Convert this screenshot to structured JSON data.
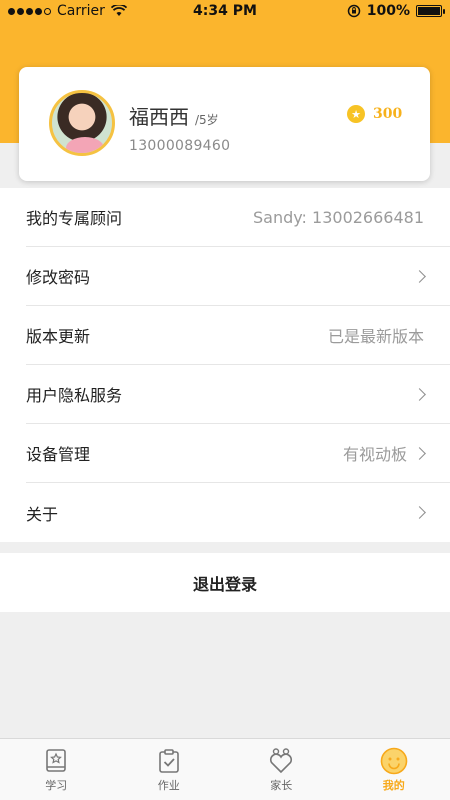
{
  "status_bar": {
    "carrier": "Carrier",
    "time": "4:34 PM",
    "battery": "100%"
  },
  "colors": {
    "accent": "#fbb52d",
    "points": "#f7b11b",
    "active_tab": "#f7a91b"
  },
  "profile": {
    "name": "福西西",
    "age": "/5岁",
    "phone": "13000089460",
    "points": "300"
  },
  "menu": {
    "items": [
      {
        "label": "我的专属顾问",
        "value": "Sandy: 13002666481",
        "chevron": false
      },
      {
        "label": "修改密码",
        "value": "",
        "chevron": true
      },
      {
        "label": "版本更新",
        "value": "已是最新版本",
        "chevron": false
      },
      {
        "label": "用户隐私服务",
        "value": "",
        "chevron": true
      },
      {
        "label": "设备管理",
        "value": "有视动板",
        "chevron": true
      },
      {
        "label": "关于",
        "value": "",
        "chevron": true
      }
    ]
  },
  "logout": {
    "label": "退出登录"
  },
  "tabs": [
    {
      "label": "学习",
      "icon": "book-star-icon"
    },
    {
      "label": "作业",
      "icon": "clipboard-check-icon"
    },
    {
      "label": "家长",
      "icon": "heart-people-icon"
    },
    {
      "label": "我的",
      "icon": "smiley-face-icon",
      "active": true
    }
  ]
}
